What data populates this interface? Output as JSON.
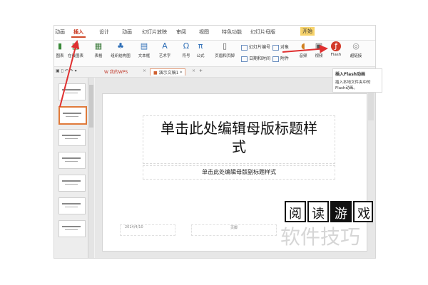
{
  "menu": {
    "tabs": [
      "动画",
      "插入",
      "设计",
      "动画",
      "幻灯片放映",
      "审阅",
      "视图",
      "特色功能",
      "幻灯片母版"
    ],
    "active_tab": "插入",
    "ctx_button": "开始"
  },
  "ribbon": {
    "buttons": [
      {
        "label": "图表",
        "icon": "chart-icon"
      },
      {
        "label": "在线图表",
        "icon": "online-chart-icon"
      },
      {
        "label": "表格",
        "icon": "table-icon"
      },
      {
        "label": "组织结构图",
        "icon": "org-chart-icon"
      },
      {
        "label": "文本框",
        "icon": "textbox-icon"
      },
      {
        "label": "艺术字",
        "icon": "wordart-icon"
      },
      {
        "label": "符号",
        "icon": "symbol-icon"
      },
      {
        "label": "公式",
        "icon": "formula-icon"
      },
      {
        "label": "页眉和页脚",
        "icon": "header-footer-icon"
      },
      {
        "label": "音频",
        "icon": "audio-icon"
      },
      {
        "label": "视频",
        "icon": "video-icon"
      },
      {
        "label": "Flash",
        "icon": "flash-icon"
      },
      {
        "label": "超链接",
        "icon": "hyperlink-icon"
      }
    ],
    "small": {
      "slide_number": "幻灯片编号",
      "object": "对象",
      "date_time": "日期和时间",
      "attachment": "附件"
    }
  },
  "doc_tabs": {
    "wps": "我的WPS",
    "current": "演示文稿1 *"
  },
  "slide": {
    "title_line1": "单击此处编辑母版标题样",
    "title_line2": "式",
    "subtitle": "单击此处编辑母版副标题样式",
    "footer_date": "2014/4/10",
    "footer_num": "页脚"
  },
  "tooltip": {
    "title": "插入Flash动画",
    "body": "插入本地文件夹中的Flash动画。"
  },
  "watermark": {
    "chars": [
      "阅",
      "读",
      "游",
      "戏"
    ],
    "text": "软件技巧"
  },
  "colors": {
    "accent": "#d04a2a",
    "annotation": "#e03030"
  }
}
